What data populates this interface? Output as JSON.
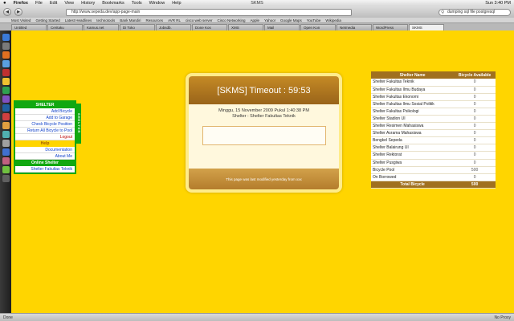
{
  "menubar": {
    "apple": "",
    "app": "Firefox",
    "items": [
      "File",
      "Edit",
      "View",
      "History",
      "Bookmarks",
      "Tools",
      "Window",
      "Help"
    ],
    "window_title": "SKMS",
    "clock": "Sun 3:40 PM"
  },
  "toolbar": {
    "url": "http://www.sepeda.dev/app-page-main",
    "search": "dumping sql file postgresql"
  },
  "bookmarks": [
    "Most Visited",
    "Getting Started",
    "Latest Headlines",
    "technotools",
    "Bank Mandiri",
    "Resources",
    "AVR RL",
    "cisco web server",
    "Cisco Networking",
    "Apple",
    "Yahoo!",
    "Google Maps",
    "YouTube",
    "Wikipedia"
  ],
  "tabs": [
    "Untitled",
    "Ceritaku",
    "Kamus.net",
    "Di Toko",
    "Jobsdb.",
    "Done Kos",
    "XMS",
    "Mail",
    "Open Kon",
    "Netmedia",
    "WordPress",
    "SKMS",
    "SKMS"
  ],
  "left_menu": {
    "shelter_head": "SHELTER",
    "items": [
      "Add Bicycle",
      "Add to Garage",
      "Check Bicycle Position",
      "Return All Bicycle to Pool",
      "Logout"
    ],
    "help_head": "Help",
    "help_items": [
      "Documentation",
      "About Me"
    ],
    "online_head": "Online Shelter",
    "online_items": [
      "Shelter Fakultas Teknik"
    ],
    "side_strip": "SHELTER"
  },
  "center_panel": {
    "timeout": "[SKMS] Timeout : 59:53",
    "date_line": "Minggu, 15 November 2009 Pukul 1:40:38 PM",
    "shelter_line": "Shelter : Shelter Fakultas Teknik",
    "footer": "This page was last modified yesterday from xxx"
  },
  "shelter_table": {
    "headers": [
      "Shelter Name",
      "Bicycle Available"
    ],
    "rows": [
      {
        "name": "Shelter Fakultas Teknik",
        "count": "0"
      },
      {
        "name": "Shelter Fakultas Ilmu Budaya",
        "count": "0"
      },
      {
        "name": "Shelter Fakultas Ekonomi",
        "count": "0"
      },
      {
        "name": "Shelter Fakultas Ilmu Sosial Politik",
        "count": "0"
      },
      {
        "name": "Shelter Fakultas Psikologi",
        "count": "0"
      },
      {
        "name": "Shelter Stadion UI",
        "count": "0"
      },
      {
        "name": "Shelter Resimen Mahasiswa",
        "count": "0"
      },
      {
        "name": "Shelter Asrama Mahasiswa",
        "count": "0"
      },
      {
        "name": "Bengkel Sepeda",
        "count": "0"
      },
      {
        "name": "Shelter Balairung UI",
        "count": "0"
      },
      {
        "name": "Shelter Rektorat",
        "count": "0"
      },
      {
        "name": "Shelter Pusgiwa",
        "count": "0"
      },
      {
        "name": "Bicycle Pool",
        "count": "500"
      },
      {
        "name": "On Borrowed",
        "count": "0"
      }
    ],
    "total_label": "Total Bicycle",
    "total_count": "500"
  },
  "statusbar": {
    "left": "Done",
    "right": "No Proxy"
  },
  "colors": {
    "page_bg": "#ffd500",
    "menu_green": "#11a811",
    "panel_brown": "#a0701f"
  }
}
